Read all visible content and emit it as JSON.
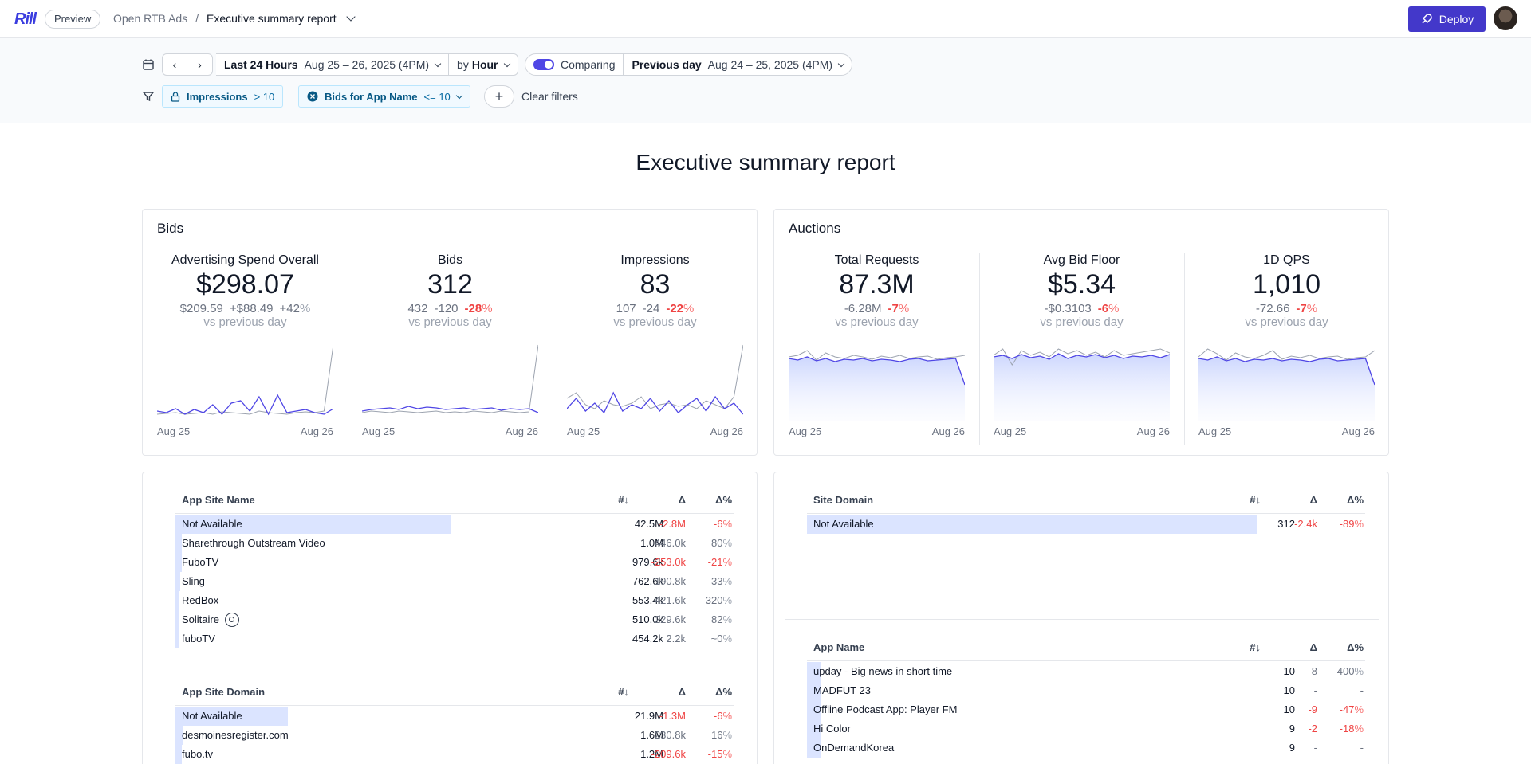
{
  "app": {
    "logo": "Rill",
    "badge": "Preview",
    "breadcrumb_project": "Open RTB Ads",
    "breadcrumb_sep": "/",
    "breadcrumb_page": "Executive summary report",
    "deploy_label": "Deploy"
  },
  "time": {
    "range_label": "Last 24 Hours",
    "range_value": "Aug 25 – 26, 2025 (4PM)",
    "grain_prefix": "by",
    "grain": "Hour",
    "comparing_label": "Comparing",
    "compare_label": "Previous day",
    "compare_value": "Aug 24 – 25, 2025 (4PM)"
  },
  "filters": [
    {
      "name": "Impressions",
      "op": "> 10",
      "icon": "lock-icon"
    },
    {
      "name": "Bids for App Name",
      "op": "<= 10",
      "icon": "x-circle-icon"
    }
  ],
  "clear_filters": "Clear filters",
  "report_title": "Executive summary report",
  "bids_card": {
    "title": "Bids",
    "kpis": [
      {
        "name": "Advertising Spend Overall",
        "value": "$298.07",
        "prev": "$209.59",
        "delta": "+$88.49",
        "pct": "+42",
        "pct_sign": "%",
        "neg": false,
        "vs": "vs previous day",
        "x_start": "Aug 25",
        "x_end": "Aug 26"
      },
      {
        "name": "Bids",
        "value": "312",
        "prev": "432",
        "delta": "-120",
        "pct": "-28",
        "pct_sign": "%",
        "neg": true,
        "vs": "vs previous day",
        "x_start": "Aug 25",
        "x_end": "Aug 26"
      },
      {
        "name": "Impressions",
        "value": "83",
        "prev": "107",
        "delta": "-24",
        "pct": "-22",
        "pct_sign": "%",
        "neg": true,
        "vs": "vs previous day",
        "x_start": "Aug 25",
        "x_end": "Aug 26"
      }
    ]
  },
  "auctions_card": {
    "title": "Auctions",
    "kpis": [
      {
        "name": "Total Requests",
        "value": "87.3M",
        "prev": "",
        "delta": "-6.28M",
        "pct": "-7",
        "pct_sign": "%",
        "neg": true,
        "vs": "vs previous day",
        "x_start": "Aug 25",
        "x_end": "Aug 26"
      },
      {
        "name": "Avg Bid Floor",
        "value": "$5.34",
        "prev": "",
        "delta": "-$0.3103",
        "pct": "-6",
        "pct_sign": "%",
        "neg": true,
        "vs": "vs previous day",
        "x_start": "Aug 25",
        "x_end": "Aug 26"
      },
      {
        "name": "1D QPS",
        "value": "1,010",
        "prev": "",
        "delta": "-72.66",
        "pct": "-7",
        "pct_sign": "%",
        "neg": true,
        "vs": "vs previous day",
        "x_start": "Aug 25",
        "x_end": "Aug 26"
      }
    ]
  },
  "table_headers": {
    "sort": "#↓",
    "delta": "Δ",
    "delta_pct": "Δ%"
  },
  "app_site_name": {
    "title": "App Site Name",
    "rows": [
      {
        "label": "Not Available",
        "value": "42.5M",
        "delta": "-2.8M",
        "pct": "-6",
        "neg": true,
        "share": 0.61
      },
      {
        "label": "Sharethrough Outstream Video",
        "value": "1.0M",
        "delta": "446.0k",
        "pct": "80",
        "neg": false,
        "share": 0.014
      },
      {
        "label": "FuboTV",
        "value": "979.6k",
        "delta": "-253.0k",
        "pct": "-21",
        "neg": true,
        "share": 0.014
      },
      {
        "label": "Sling",
        "value": "762.6k",
        "delta": "190.8k",
        "pct": "33",
        "neg": false,
        "share": 0.011
      },
      {
        "label": "RedBox",
        "value": "553.4k",
        "delta": "421.6k",
        "pct": "320",
        "neg": false,
        "share": 0.008
      },
      {
        "label": "Solitaire",
        "value": "510.0k",
        "delta": "229.6k",
        "pct": "82",
        "neg": false,
        "share": 0.007
      },
      {
        "label": "fuboTV",
        "value": "454.2k",
        "delta": "2.2k",
        "pct": "~0",
        "neg": false,
        "share": 0.006
      }
    ]
  },
  "app_site_domain": {
    "title": "App Site Domain",
    "rows": [
      {
        "label": "Not Available",
        "value": "21.9M",
        "delta": "-1.3M",
        "pct": "-6",
        "neg": true,
        "share": 0.25
      },
      {
        "label": "desmoinesregister.com",
        "value": "1.6M",
        "delta": "230.8k",
        "pct": "16",
        "neg": false,
        "share": 0.018
      },
      {
        "label": "fubo.tv",
        "value": "1.2M",
        "delta": "-209.6k",
        "pct": "-15",
        "neg": true,
        "share": 0.014
      }
    ]
  },
  "site_domain": {
    "title": "Site Domain",
    "rows": [
      {
        "label": "Not Available",
        "value": "312",
        "delta": "-2.4k",
        "pct": "-89",
        "neg": true,
        "share": 1.0
      }
    ]
  },
  "app_name": {
    "title": "App Name",
    "rows": [
      {
        "label": "upday - Big news in short time",
        "value": "10",
        "delta": "8",
        "pct": "400",
        "neg": false,
        "share": 0.03
      },
      {
        "label": "MADFUT 23",
        "value": "10",
        "delta": "-",
        "pct": "-",
        "neg": false,
        "share": 0.03
      },
      {
        "label": "Offline Podcast App: Player FM",
        "value": "10",
        "delta": "-9",
        "pct": "-47",
        "neg": true,
        "share": 0.03
      },
      {
        "label": "Hi Color",
        "value": "9",
        "delta": "-2",
        "pct": "-18",
        "neg": true,
        "share": 0.03
      },
      {
        "label": "OnDemandKorea",
        "value": "9",
        "delta": "-",
        "pct": "-",
        "neg": false,
        "share": 0.03
      }
    ]
  },
  "colors": {
    "accent": "#4338ca",
    "negative": "#ef4444",
    "bar": "#dbe4ff",
    "spark_current": "#4f46e5",
    "spark_previous": "#9ca3af"
  }
}
